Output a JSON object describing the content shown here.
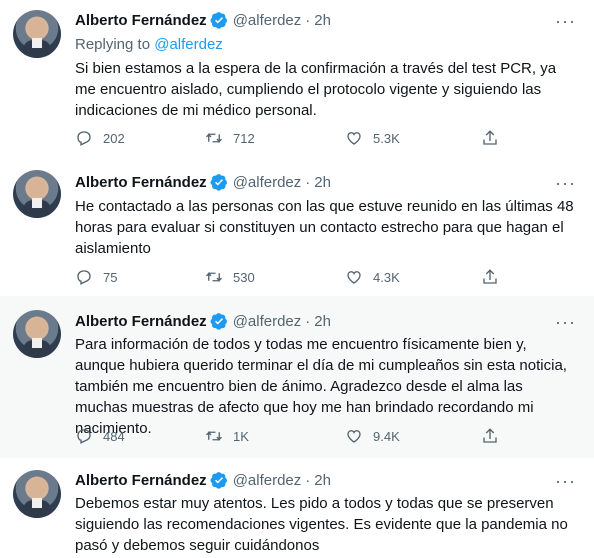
{
  "tweets": [
    {
      "name": "Alberto Fernández",
      "handle": "@alferdez",
      "time": "2h",
      "replying_prefix": "Replying to ",
      "replying_to": "@alferdez",
      "text": "Si bien estamos a la espera de la confirmación a través del test PCR, ya me encuentro aislado, cumpliendo el protocolo vigente y siguiendo las indicaciones de mi médico personal.",
      "replies": "202",
      "retweets": "712",
      "likes": "5.3K"
    },
    {
      "name": "Alberto Fernández",
      "handle": "@alferdez",
      "time": "2h",
      "text": "He contactado a las personas con las que estuve reunido en las últimas 48 horas para evaluar si constituyen un contacto estrecho para que hagan el aislamiento",
      "replies": "75",
      "retweets": "530",
      "likes": "4.3K"
    },
    {
      "name": "Alberto Fernández",
      "handle": "@alferdez",
      "time": "2h",
      "text": "Para información de todos y todas me encuentro físicamente bien y, aunque hubiera querido terminar el día de mi cumpleaños sin esta noticia, también me encuentro bien de ánimo. Agradezco desde el alma las muchas muestras de afecto que hoy me han brindado recordando mi nacimiento.",
      "replies": "484",
      "retweets": "1K",
      "likes": "9.4K"
    },
    {
      "name": "Alberto Fernández",
      "handle": "@alferdez",
      "time": "2h",
      "text": "Debemos estar muy atentos. Les pido a todos y todas que se preserven siguiendo las recomendaciones vigentes. Es evidente que la pandemia no pasó y debemos seguir cuidándonos"
    }
  ],
  "icons": {
    "reply": "reply-icon",
    "retweet": "retweet-icon",
    "like": "heart-icon",
    "share": "share-icon",
    "more": "more-icon",
    "verified": "verified-badge-icon"
  },
  "colors": {
    "accent": "#1d9bf0",
    "text": "#0f1419",
    "muted": "#536471",
    "highlight_bg": "#f7f9f9"
  }
}
